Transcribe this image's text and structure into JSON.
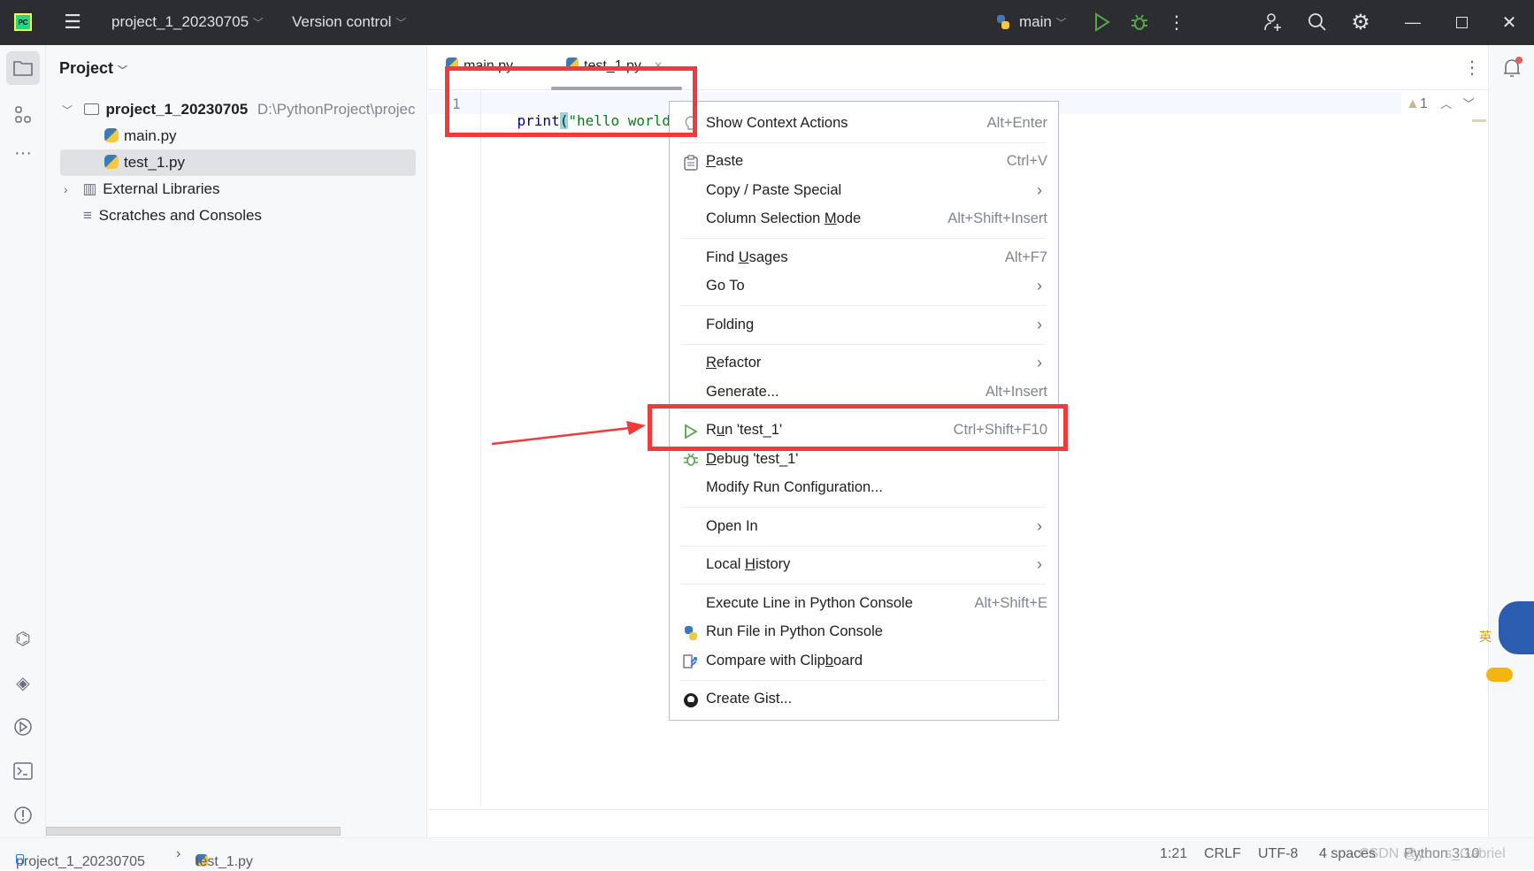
{
  "titlebar": {
    "project": "project_1_20230705",
    "vcs": "Version control",
    "run_config": "main"
  },
  "project_panel": {
    "title": "Project",
    "root": {
      "name": "project_1_20230705",
      "path": "D:\\PythonProject\\projec"
    },
    "files": [
      "main.py",
      "test_1.py"
    ],
    "external": "External Libraries",
    "scratches": "Scratches and Consoles"
  },
  "editor": {
    "tabs": [
      {
        "label": "main.py"
      },
      {
        "label": "test_1.py",
        "active": true
      }
    ],
    "line_number": "1",
    "code": {
      "fn": "print",
      "open": "(",
      "str": "\"hello world\"",
      "close": ")"
    },
    "warnings": "1"
  },
  "menu": {
    "items": [
      {
        "label": "Show Context Actions",
        "shortcut": "Alt+Enter",
        "icon": "lightbulb-icon",
        "mn": -1
      },
      {
        "sep": true
      },
      {
        "label": "Paste",
        "shortcut": "Ctrl+V",
        "icon": "clipboard-icon",
        "mn": 0
      },
      {
        "label": "Copy / Paste Special",
        "submenu": true,
        "mn": -1
      },
      {
        "label": "Column Selection Mode",
        "shortcut": "Alt+Shift+Insert",
        "mn": 17
      },
      {
        "sep": true
      },
      {
        "label": "Find Usages",
        "shortcut": "Alt+F7",
        "mn": 5
      },
      {
        "label": "Go To",
        "submenu": true,
        "mn": -1
      },
      {
        "sep": true
      },
      {
        "label": "Folding",
        "submenu": true,
        "mn": -1
      },
      {
        "sep": true
      },
      {
        "label": "Refactor",
        "submenu": true,
        "mn": 0
      },
      {
        "label": "Generate...",
        "shortcut": "Alt+Insert",
        "mn": -1
      },
      {
        "sep": true
      },
      {
        "label": "Run 'test_1'",
        "shortcut": "Ctrl+Shift+F10",
        "icon": "run-icon",
        "mn": 1
      },
      {
        "label": "Debug 'test_1'",
        "icon": "debug-icon",
        "mn": 0
      },
      {
        "label": "Modify Run Configuration...",
        "mn": -1
      },
      {
        "sep": true
      },
      {
        "label": "Open In",
        "submenu": true,
        "mn": -1
      },
      {
        "sep": true
      },
      {
        "label": "Local History",
        "submenu": true,
        "mn": 6
      },
      {
        "sep": true
      },
      {
        "label": "Execute Line in Python Console",
        "shortcut": "Alt+Shift+E",
        "mn": -1
      },
      {
        "label": "Run File in Python Console",
        "icon": "python-icon",
        "mn": -1
      },
      {
        "label": "Compare with Clipboard",
        "icon": "compare-icon",
        "mn": 17
      },
      {
        "sep": true
      },
      {
        "label": "Create Gist...",
        "icon": "github-icon",
        "mn": -1
      }
    ]
  },
  "status": {
    "project": "project_1_20230705",
    "file": "test_1.py",
    "position": "1:21",
    "line_sep": "CRLF",
    "encoding": "UTF-8",
    "indent": "4 spaces",
    "interpreter": "Python 3.10",
    "watermark": "CSDN @yours_Gabriel"
  },
  "colors": {
    "accent_red": "#f23a3a",
    "run_green": "#4caf50",
    "titlebar": "#2b2d30"
  }
}
